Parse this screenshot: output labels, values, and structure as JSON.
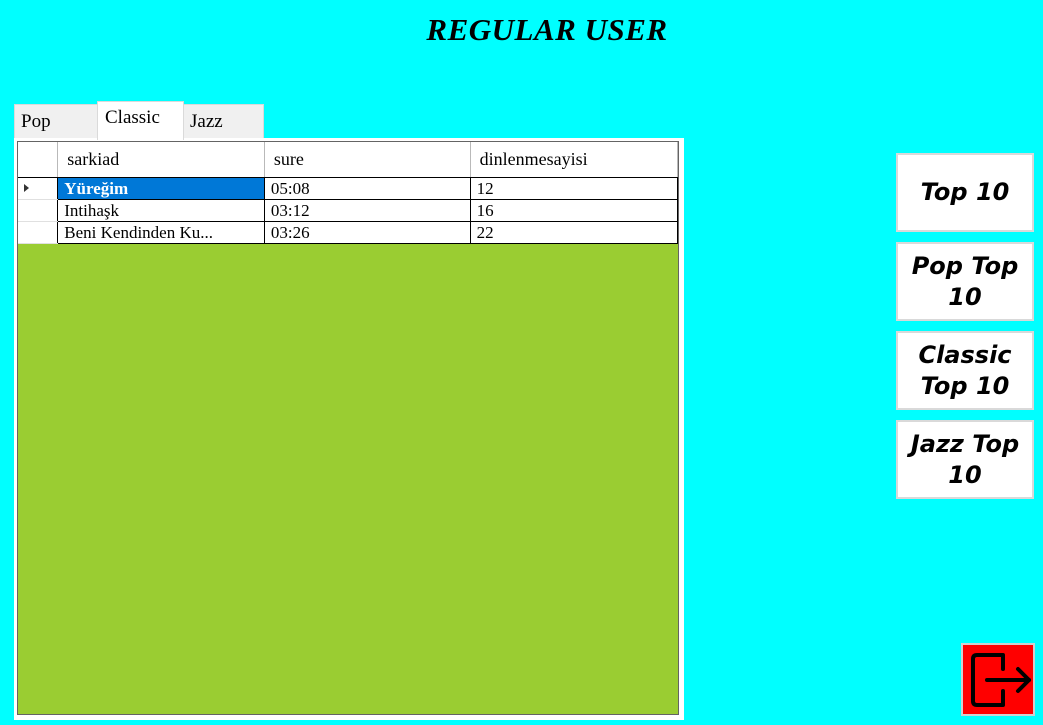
{
  "window": {
    "title": "REGULAR USER"
  },
  "tabs": [
    {
      "label": "Pop",
      "active": false
    },
    {
      "label": "Classic",
      "active": true
    },
    {
      "label": "Jazz",
      "active": false
    }
  ],
  "grid": {
    "columns": [
      "sarkiad",
      "sure",
      "dinlenmesayisi"
    ],
    "rows": [
      {
        "sarkiad": "Yüreğim",
        "sure": "05:08",
        "dinlenmesayisi": "12",
        "selected": true
      },
      {
        "sarkiad": "Intihaşk",
        "sure": "03:12",
        "dinlenmesayisi": "16",
        "selected": false
      },
      {
        "sarkiad": "Beni Kendinden Ku...",
        "sure": "03:26",
        "dinlenmesayisi": "22",
        "selected": false
      }
    ],
    "background_color": "#9ACD32",
    "selection_color": "#0078D7"
  },
  "side_buttons": {
    "top10": "Top 10",
    "pop_top10": "Pop Top 10",
    "classic_top10": "Classic Top 10",
    "jazz_top10": "Jazz Top 10"
  },
  "exit_button": {
    "icon": "exit-icon",
    "color": "#FF0000"
  },
  "theme": {
    "background": "#00FFFF"
  }
}
